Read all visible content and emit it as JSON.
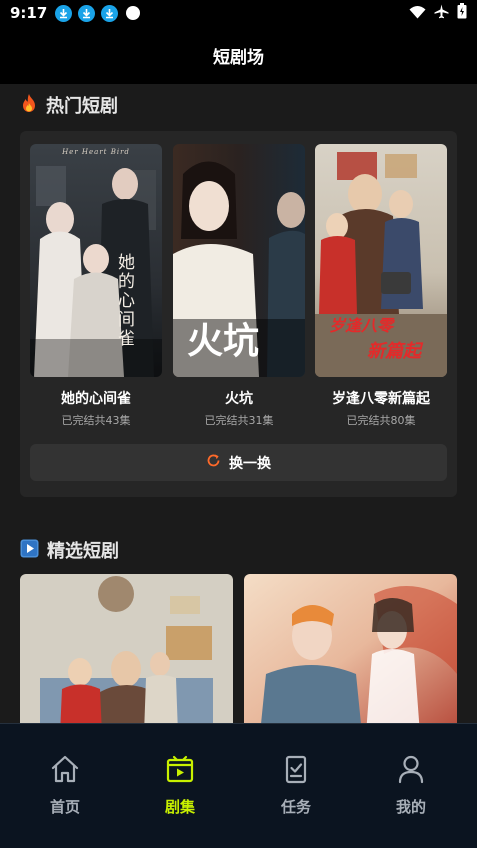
{
  "status_bar": {
    "time": "9:17"
  },
  "header": {
    "title": "短剧场"
  },
  "hot_section": {
    "title": "热门短剧",
    "items": [
      {
        "title": "她的心间雀",
        "subtitle": "已完结共43集",
        "poster_text": "她的心间雀",
        "poster_header": "Her Heart Bird"
      },
      {
        "title": "火坑",
        "subtitle": "已完结共31集",
        "poster_text": "火坑"
      },
      {
        "title": "岁逢八零新篇起",
        "subtitle": "已完结共80集",
        "poster_text_1": "岁逢八零",
        "poster_text_2": "新篇起"
      }
    ],
    "refresh_label": "换一换"
  },
  "featured_section": {
    "title": "精选短剧"
  },
  "tabbar": {
    "items": [
      {
        "label": "首页",
        "icon": "home-icon"
      },
      {
        "label": "剧集",
        "icon": "play-tv-icon",
        "active": true
      },
      {
        "label": "任务",
        "icon": "task-icon"
      },
      {
        "label": "我的",
        "icon": "user-icon"
      }
    ]
  },
  "colors": {
    "accent": "#c8f000",
    "background": "#1b1b1b",
    "card": "#262626",
    "refresh_icon": "#ff6a2a"
  }
}
